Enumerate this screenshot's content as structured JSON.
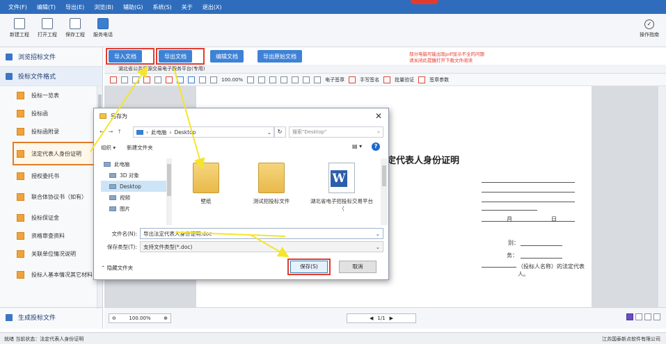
{
  "menu": [
    "文件(F)",
    "编辑(T)",
    "导出(E)",
    "浏览(B)",
    "辅助(G)",
    "系统(S)",
    "关于",
    "退出(X)"
  ],
  "toolbar": {
    "new_project": "新建工程",
    "open_project": "打开工程",
    "save_project": "保存工程",
    "report_phone": "服务电话",
    "help": "操作指南"
  },
  "sidebar": {
    "browse_tender": "浏览招标文件",
    "bid_format": "投标文件格式",
    "items": [
      "投标一览表",
      "投标函",
      "投标函附录",
      "法定代表人身份证明",
      "授权委托书",
      "联合体协议书（如有）",
      "投标保证金",
      "资格审查资料",
      "关联单位情况说明",
      "投标人基本情况其它材料"
    ],
    "generate": "生成投标文件"
  },
  "actions": {
    "import_doc": "导入文档",
    "export_doc": "导出文档",
    "edit_doc": "编辑文档",
    "export_original": "导出原始文档"
  },
  "warning": [
    "部分电脑可能出现pdf显示不全的问题",
    "请关闭此提醒打开下载文件阅读"
  ],
  "doc_tab_title": "湖北省公共资源交易电子服务平台(专用)",
  "pdf_toolbar": {
    "zoom": "100.00%",
    "e_sign": "电子签章",
    "hand_sign": "手写签名",
    "batch_verify": "批量验证",
    "sign_params": "签章参数"
  },
  "page": {
    "heading": "定代表人身份证明",
    "month": "月",
    "day": "日",
    "gender": "别：",
    "position": "务：",
    "bidder_note": "（投标人名称）的法定代表人。"
  },
  "pager": {
    "zoom": "100.00%",
    "page": "1/1"
  },
  "dialog": {
    "title": "另存为",
    "path": [
      "此电脑",
      "Desktop"
    ],
    "search_placeholder": "搜索\"Desktop\"",
    "organize": "组织 ▾",
    "new_folder": "新建文件夹",
    "tree": [
      "此电脑",
      "3D 对象",
      "Desktop",
      "视频",
      "图片"
    ],
    "files": [
      "壁纸",
      "测试招投标文件",
      "湖北省电子招投标交易平台（"
    ],
    "filename_label": "文件名(N):",
    "filename_value": "导出法定代表人身份证明.doc",
    "type_label": "保存类型(T):",
    "type_value": "支持文件类型(*.doc)",
    "hide_folders": "隐藏文件夹",
    "save": "保存(S)",
    "cancel": "取消"
  },
  "status": {
    "left": "就绪  当前状态：法定代表人身份证明",
    "right": "江苏国泰新点软件有限公司"
  }
}
